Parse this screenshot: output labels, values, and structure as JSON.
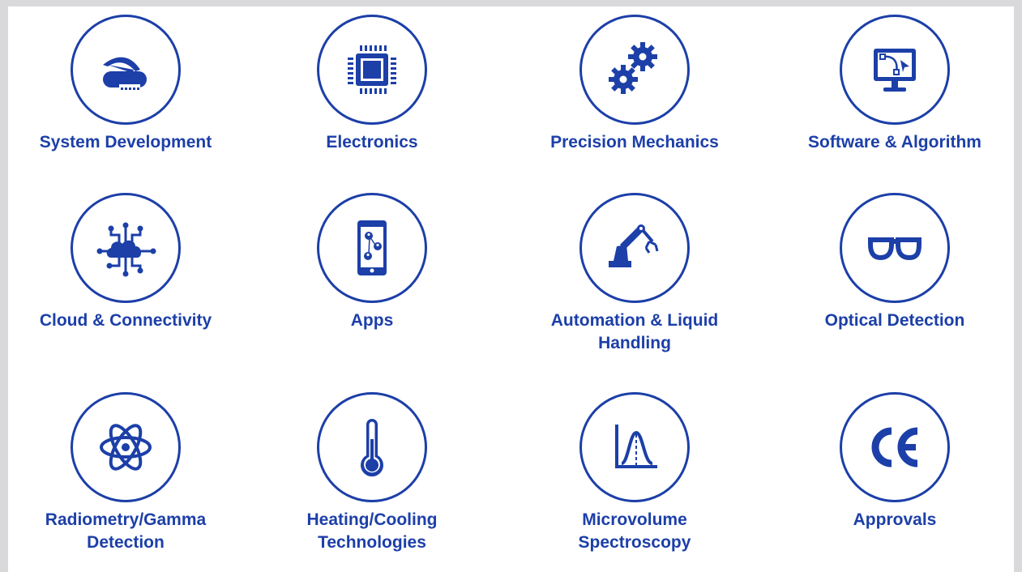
{
  "accent_color": "#1c3fa8",
  "tiles": [
    {
      "label": "System Development",
      "icon": "pocket-knife-icon"
    },
    {
      "label": "Electronics",
      "icon": "microchip-icon"
    },
    {
      "label": "Precision Mechanics",
      "icon": "gears-icon"
    },
    {
      "label": "Software & Algorithm",
      "icon": "monitor-bezier-curve-icon"
    },
    {
      "label": "Cloud & Connectivity",
      "icon": "cloud-network-icon"
    },
    {
      "label": "Apps",
      "icon": "smartphone-network-icon"
    },
    {
      "label": "Automation & Liquid\nHandling",
      "icon": "robot-arm-icon"
    },
    {
      "label": "Optical Detection",
      "icon": "glasses-icon"
    },
    {
      "label": "Radiometry/Gamma\nDetection",
      "icon": "atom-icon"
    },
    {
      "label": "Heating/Cooling\nTechnologies",
      "icon": "thermometer-icon"
    },
    {
      "label": "Microvolume\nSpectroscopy",
      "icon": "spectrum-peak-icon"
    },
    {
      "label": "Approvals",
      "icon": "ce-mark-icon"
    }
  ]
}
